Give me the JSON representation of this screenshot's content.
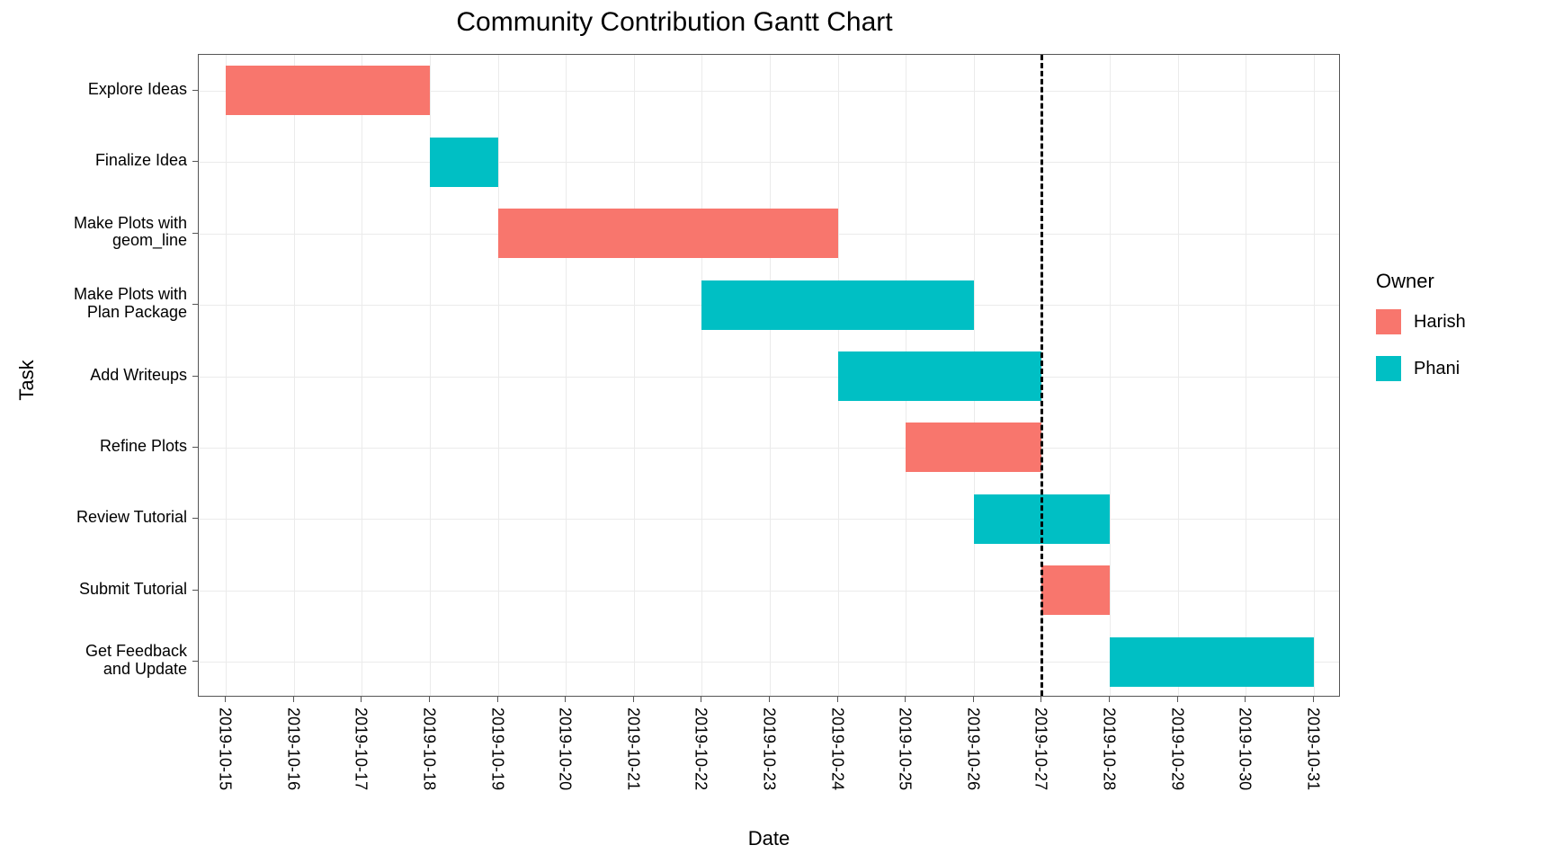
{
  "chart_data": {
    "type": "bar",
    "title": "Community Contribution Gantt Chart",
    "xlabel": "Date",
    "ylabel": "Task",
    "xlim": [
      "2019-10-14.6",
      "2019-10-31.4"
    ],
    "x_ticks": [
      "2019-10-15",
      "2019-10-16",
      "2019-10-17",
      "2019-10-18",
      "2019-10-19",
      "2019-10-20",
      "2019-10-21",
      "2019-10-22",
      "2019-10-23",
      "2019-10-24",
      "2019-10-25",
      "2019-10-26",
      "2019-10-27",
      "2019-10-28",
      "2019-10-29",
      "2019-10-30",
      "2019-10-31"
    ],
    "y_categories": [
      "Explore Ideas",
      "Finalize Idea",
      "Make Plots with geom_line",
      "Make Plots with Plan Package",
      "Add Writeups",
      "Refine Plots",
      "Review Tutorial",
      "Submit Tutorial",
      "Get Feedback and Update"
    ],
    "tasks": [
      {
        "task": "Explore Ideas",
        "start": "2019-10-15",
        "end": "2019-10-18",
        "owner": "Harish"
      },
      {
        "task": "Finalize Idea",
        "start": "2019-10-18",
        "end": "2019-10-19",
        "owner": "Phani"
      },
      {
        "task": "Make Plots with geom_line",
        "start": "2019-10-19",
        "end": "2019-10-24",
        "owner": "Harish"
      },
      {
        "task": "Make Plots with Plan Package",
        "start": "2019-10-22",
        "end": "2019-10-26",
        "owner": "Phani"
      },
      {
        "task": "Add Writeups",
        "start": "2019-10-24",
        "end": "2019-10-27",
        "owner": "Phani"
      },
      {
        "task": "Refine Plots",
        "start": "2019-10-25",
        "end": "2019-10-27",
        "owner": "Harish"
      },
      {
        "task": "Review Tutorial",
        "start": "2019-10-26",
        "end": "2019-10-28",
        "owner": "Phani"
      },
      {
        "task": "Submit Tutorial",
        "start": "2019-10-27",
        "end": "2019-10-28",
        "owner": "Harish"
      },
      {
        "task": "Get Feedback and Update",
        "start": "2019-10-28",
        "end": "2019-10-31",
        "owner": "Phani"
      }
    ],
    "reference_line": "2019-10-27",
    "legend": {
      "title": "Owner",
      "items": [
        {
          "label": "Harish",
          "color": "#f8766d"
        },
        {
          "label": "Phani",
          "color": "#00bfc4"
        }
      ]
    }
  },
  "y_tick_labels": {
    "0": "Explore Ideas",
    "1": "Finalize Idea",
    "2a": "Make Plots with",
    "2b": "geom_line",
    "3a": "Make Plots with",
    "3b": "Plan Package",
    "4": "Add Writeups",
    "5": "Refine Plots",
    "6": "Review Tutorial",
    "7": "Submit Tutorial",
    "8a": "Get Feedback",
    "8b": "and Update"
  }
}
